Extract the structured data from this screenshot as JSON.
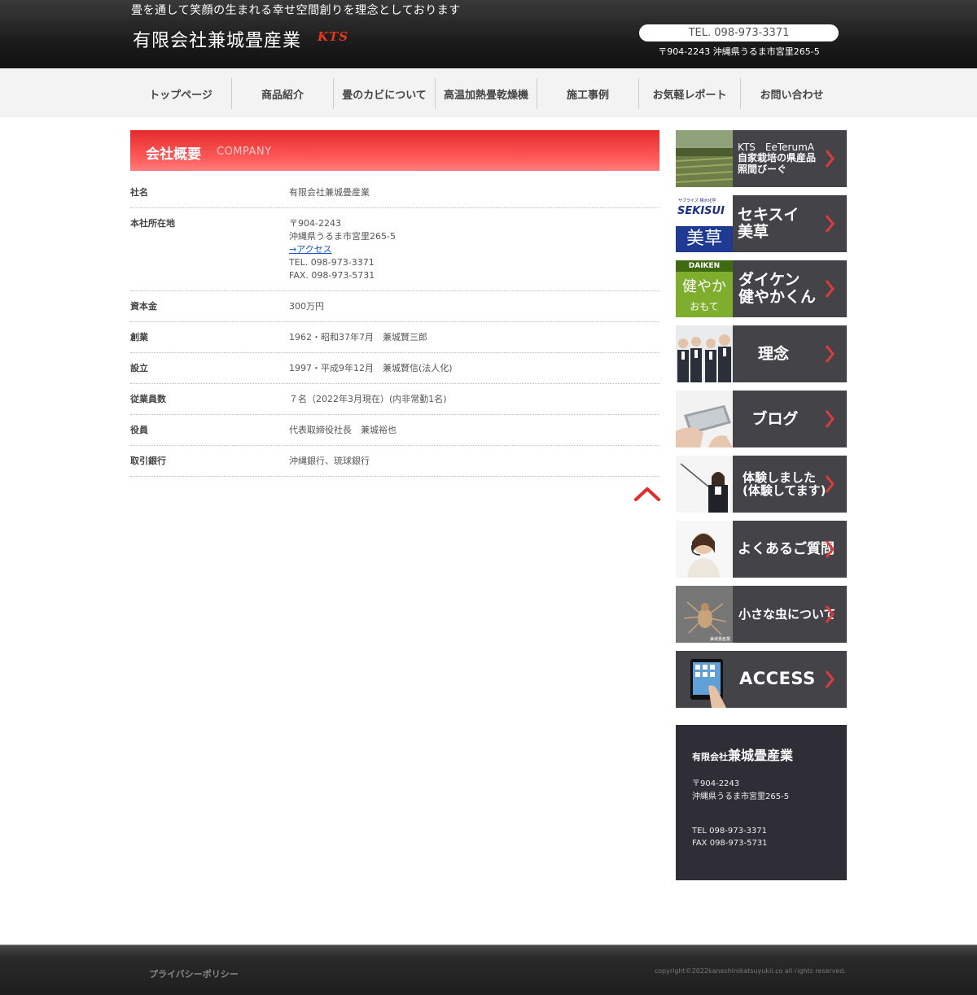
{
  "header": {
    "tagline": "畳を通して笑顔の生まれる幸せ空間創りを理念としております",
    "logo_text": "有限会社兼城畳産業",
    "logo_mark": "KTS",
    "tel": "TEL. 098-973-3371",
    "address": "〒904-2243 沖縄県うるま市宮里265-5"
  },
  "nav": {
    "items": [
      "トップページ",
      "商品紹介",
      "畳のカビについて",
      "高温加熱畳乾燥機",
      "施工事例",
      "お気軽レポート",
      "お問い合わせ"
    ]
  },
  "section": {
    "title_jp": "会社概要",
    "title_en": "COMPANY"
  },
  "company_info": [
    {
      "label": "社名",
      "lines": [
        "有限会社兼城畳産業"
      ]
    },
    {
      "label": "本社所在地",
      "lines": [
        "〒904-2243",
        "沖縄県うるま市宮里265-5"
      ],
      "link": "→アクセス",
      "lines_after": [
        "TEL. 098-973-3371",
        "FAX. 098-973-5731"
      ]
    },
    {
      "label": "資本金",
      "lines": [
        "300万円"
      ]
    },
    {
      "label": "創業",
      "lines": [
        "1962・昭和37年7月　兼城賢三郎"
      ]
    },
    {
      "label": "設立",
      "lines": [
        "1997・平成9年12月　兼城賢信(法人化)"
      ]
    },
    {
      "label": "従業員数",
      "lines": [
        "７名（2022年3月現在）(内非常勤1名)"
      ]
    },
    {
      "label": "役員",
      "lines": [
        "代表取締役社長　兼城裕也"
      ]
    },
    {
      "label": "取引銀行",
      "lines": [
        "沖縄銀行、琉球銀行"
      ]
    }
  ],
  "sidebar": {
    "banners": [
      {
        "lines": [
          "KTS　EeTerumA",
          "自家栽培の県産品",
          "照間びーぐ"
        ],
        "thumb_label": ""
      },
      {
        "lines": [
          "セキスイ",
          "美草"
        ],
        "thumb_label": "SEKISUI",
        "thumb_label2": "美草",
        "thumb_tiny": "サプライズ 積水化学"
      },
      {
        "lines": [
          "ダイケン",
          "健やかくん"
        ],
        "thumb_label": "DAIKEN",
        "thumb_label2": "健やか",
        "thumb_label3": "おもて"
      },
      {
        "lines": [
          "理念"
        ]
      },
      {
        "lines": [
          "ブログ"
        ]
      },
      {
        "lines": [
          "体験しました",
          "(体験してます)"
        ]
      },
      {
        "lines": [
          "よくあるご質問"
        ]
      },
      {
        "lines": [
          "小さな虫について"
        ],
        "thumb_tiny": "兼城畳産業"
      },
      {
        "lines": [
          "ACCESS"
        ]
      }
    ],
    "company_box": {
      "name_small": "有限会社",
      "name_big": "兼城畳産業",
      "postal": "〒904-2243",
      "address": "沖縄県うるま市宮里265-5",
      "tel": "TEL 098-973-3371",
      "fax": "FAX 098-973-5731"
    }
  },
  "footer": {
    "privacy": "プライバシーポリシー",
    "copyright": "copyright©2022kaneshirokatsuyukii.co all rights reserved."
  },
  "colors": {
    "accent_red": "#e52b2b",
    "banner_bg": "#444448",
    "box_bg": "#2f2e36"
  }
}
